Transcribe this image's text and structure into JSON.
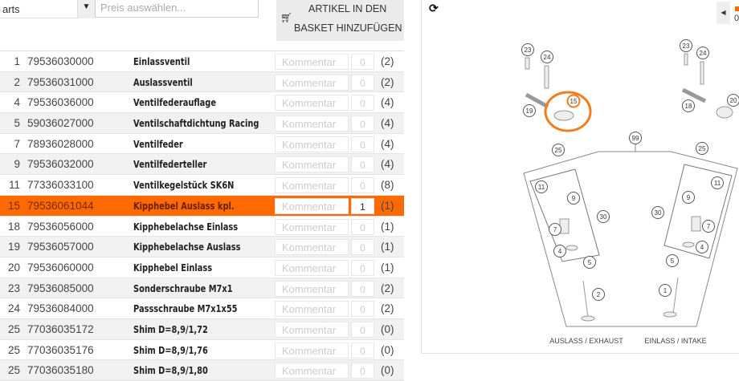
{
  "toolbar": {
    "select_value": "arts",
    "price_placeholder": "Preis auswählen...",
    "basket_line1": "ARTIKEL IN DEN",
    "basket_line2": "BASKET HINZUFÜGEN"
  },
  "rows": [
    {
      "pos": "1",
      "part": "79536030000",
      "name": "Einlassventil",
      "comment": "Kommentar",
      "qty": "0",
      "count": "(2)"
    },
    {
      "pos": "2",
      "part": "79536031000",
      "name": "Auslassventil",
      "comment": "Kommentar",
      "qty": "0",
      "count": "(2)"
    },
    {
      "pos": "4",
      "part": "79536036000",
      "name": "Ventilfederauflage",
      "comment": "Kommentar",
      "qty": "0",
      "count": "(4)"
    },
    {
      "pos": "5",
      "part": "59036027000",
      "name": "Ventilschaftdichtung Racing",
      "comment": "Kommentar",
      "qty": "0",
      "count": "(4)"
    },
    {
      "pos": "7",
      "part": "78936028000",
      "name": "Ventilfeder",
      "comment": "Kommentar",
      "qty": "0",
      "count": "(4)"
    },
    {
      "pos": "9",
      "part": "79536032000",
      "name": "Ventilfederteller",
      "comment": "Kommentar",
      "qty": "0",
      "count": "(4)"
    },
    {
      "pos": "11",
      "part": "77336033100",
      "name": "Ventilkegelstück SK6N",
      "comment": "Kommentar",
      "qty": "0",
      "count": "(8)"
    },
    {
      "pos": "15",
      "part": "79536061044",
      "name": "Kipphebel Auslass kpl.",
      "comment": "Kommentar",
      "qty": "1",
      "count": "(1)",
      "selected": true
    },
    {
      "pos": "18",
      "part": "79536056000",
      "name": "Kipphebelachse Einlass",
      "comment": "Kommentar",
      "qty": "0",
      "count": "(1)"
    },
    {
      "pos": "19",
      "part": "79536057000",
      "name": "Kipphebelachse Auslass",
      "comment": "Kommentar",
      "qty": "0",
      "count": "(1)"
    },
    {
      "pos": "20",
      "part": "79536060000",
      "name": "Kipphebel Einlass",
      "comment": "Kommentar",
      "qty": "0",
      "count": "(1)"
    },
    {
      "pos": "23",
      "part": "79536085000",
      "name": "Sonderschraube M7x1",
      "comment": "Kommentar",
      "qty": "0",
      "count": "(2)"
    },
    {
      "pos": "24",
      "part": "79536084000",
      "name": "Passschraube M7x1x55",
      "comment": "Kommentar",
      "qty": "0",
      "count": "(2)"
    },
    {
      "pos": "25",
      "part": "77036035172",
      "name": "Shim D=8,9/1,72",
      "comment": "Kommentar",
      "qty": "0",
      "count": "(0)"
    },
    {
      "pos": "25",
      "part": "77036035176",
      "name": "Shim D=8,9/1,76",
      "comment": "Kommentar",
      "qty": "0",
      "count": "(0)"
    },
    {
      "pos": "25",
      "part": "77036035180",
      "name": "Shim D=8,9/1,80",
      "comment": "Kommentar",
      "qty": "0",
      "count": "(0)"
    }
  ],
  "diagram": {
    "refresh_icon": "refresh-icon",
    "prev_icon": "caret-left-icon",
    "page_indicator": "0",
    "label_exhaust": "AUSLASS / EXHAUST",
    "label_intake": "EINLASS / INTAKE",
    "highlight_color": "#f07d1e",
    "selected_callout": "15",
    "callouts": [
      "23",
      "24",
      "19",
      "15",
      "23",
      "24",
      "18",
      "20",
      "99",
      "25",
      "25",
      "11",
      "9",
      "30",
      "7",
      "4",
      "5",
      "2",
      "30",
      "9",
      "11",
      "7",
      "4",
      "5",
      "1"
    ]
  },
  "colors": {
    "accent": "#ff6a00"
  }
}
